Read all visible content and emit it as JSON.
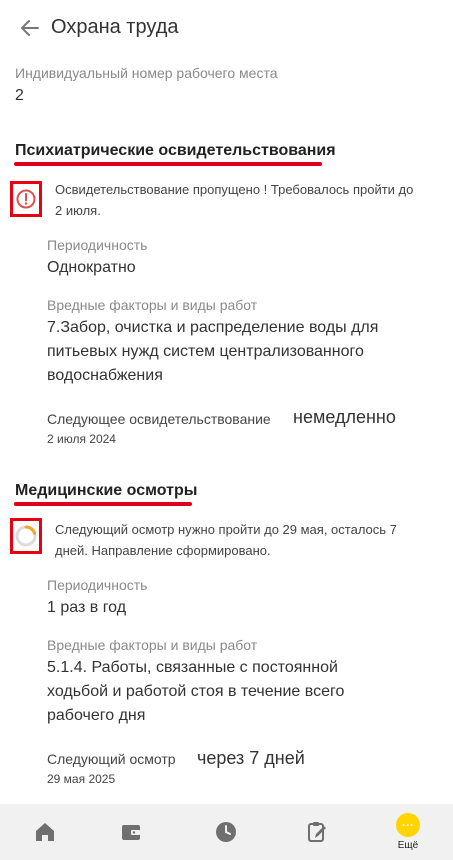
{
  "header": {
    "title": "Охрана труда"
  },
  "workplace": {
    "label": "Индивидуальный номер рабочего места",
    "value": "2"
  },
  "psych": {
    "title": "Психиатрические освидетельствования",
    "status_line1": "Освидетельствование пропущено ! Требовалось пройти до",
    "status_line2": "2 июля.",
    "periodicity_label": "Периодичность",
    "periodicity_value": "Однократно",
    "factors_label": "Вредные факторы и виды работ",
    "factors_line1": "7.Забор, очистка и распределение воды для",
    "factors_line2": "питьевых нужд систем централизованного",
    "factors_line3": "водоснабжения",
    "next_label": "Следующее освидетельствование",
    "next_value": "немедленно",
    "next_date": "2 июля 2024"
  },
  "medical": {
    "title": "Медицинские осмотры",
    "status_line1": "Следующий осмотр нужно пройти до 29 мая, осталось 7",
    "status_line2": "дней. Направление сформировано.",
    "periodicity_label": "Периодичность",
    "periodicity_value": "1 раз в год",
    "factors_label": "Вредные факторы и виды работ",
    "factors_line1": "5.1.4. Работы, связанные с постоянной",
    "factors_line2": "ходьбой и работой стоя в течение всего",
    "factors_line3": "рабочего дня",
    "next_label": "Следующий осмотр",
    "next_value": "через 7 дней",
    "next_date": "29 мая 2025"
  },
  "nav": {
    "more_icon": "···",
    "more_label": "Ещё"
  },
  "colors": {
    "accent_red": "#e60012",
    "warning_yellow": "#ffd400",
    "progress_orange": "#f5a623"
  }
}
